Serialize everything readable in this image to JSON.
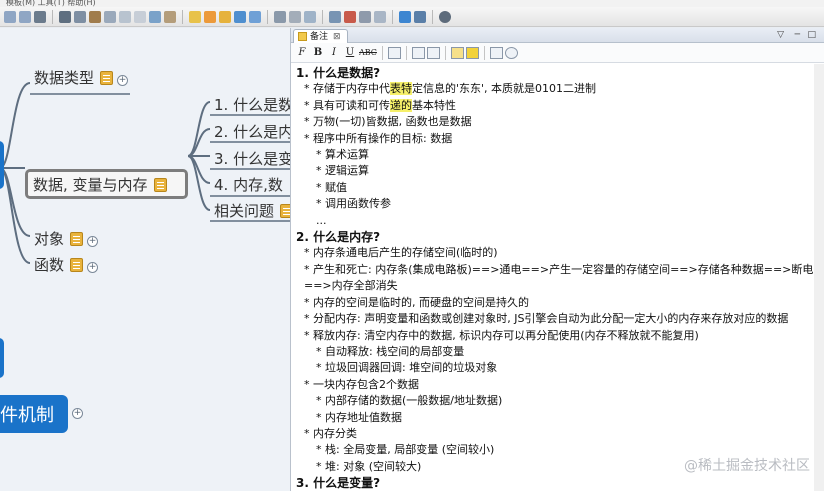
{
  "menubar": {
    "text": "模板(M)  工具(T)  帮助(H)"
  },
  "mindmap": {
    "node_data_types": "数据类型",
    "node_selected": "数据, 变量与内存",
    "node_object": "对象",
    "node_function": "函数",
    "node_event": "件机制",
    "children": [
      "1. 什么是数",
      "2. 什么是内",
      "3. 什么是变",
      "4. 内存,数",
      "相关问题"
    ]
  },
  "panel": {
    "tab_label": "备注",
    "tab_close": "⊠",
    "win_controls": [
      "▽",
      "─",
      "□"
    ],
    "format_buttons": [
      "F",
      "B",
      "I",
      "U",
      "ABC"
    ]
  },
  "notes": {
    "h1": "1. 什么是数据?",
    "h1_items": [
      "存储于内存中代表特定信息的'东东', 本质就是0101二进制",
      "具有可读和可传递的基本特性",
      "万物(一切)皆数据, 函数也是数据",
      "程序中所有操作的目标: 数据"
    ],
    "h1_sub": [
      "算术运算",
      "逻辑运算",
      "赋值",
      "调用函数传参"
    ],
    "ellipsis": "...",
    "h2": "2. 什么是内存?",
    "h2_items": [
      "内存条通电后产生的存储空间(临时的)",
      "产生和死亡: 内存条(集成电路板)==>通电==>产生一定容量的存储空间==>存储各种数据==>断电==>内存全部消失",
      "内存的空间是临时的, 而硬盘的空间是持久的",
      "分配内存: 声明变量和函数或创建对象时, JS引擎会自动为此分配一定大小的内存来存放对应的数据",
      "释放内存: 清空内存中的数据, 标识内存可以再分配使用(内存不释放就不能复用)"
    ],
    "release_sub": [
      "自动释放: 栈空间的局部变量",
      "垃圾回调器回调: 堆空间的垃圾对象"
    ],
    "block_item": "一块内存包含2个数据",
    "block_sub": [
      "内部存储的数据(一般数据/地址数据)",
      "内存地址值数据"
    ],
    "category_item": "内存分类",
    "category_sub": [
      "栈: 全局变量, 局部变量 (空间较小)",
      "堆: 对象 (空间较大)"
    ],
    "h3": "3. 什么是变量?"
  },
  "watermark": "@稀土掘金技术社区",
  "colors": {
    "accent_blue": "#1a73c9",
    "note_icon": "#e9b33c",
    "highlight": "#f6f06a"
  }
}
